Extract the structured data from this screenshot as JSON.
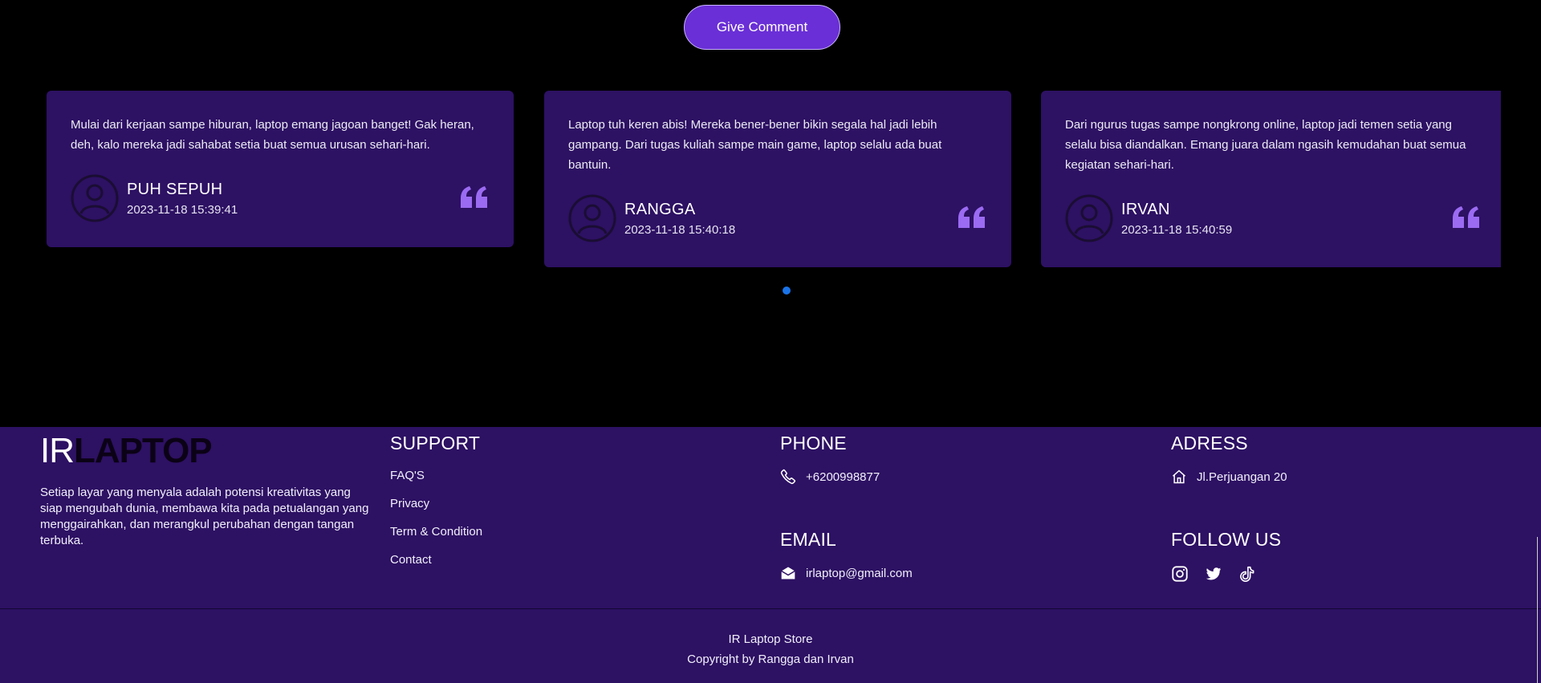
{
  "comment_button": {
    "label": "Give Comment"
  },
  "testimonials": [
    {
      "text": "Mulai dari kerjaan sampe hiburan, laptop emang jagoan banget! Gak heran, deh, kalo mereka jadi sahabat setia buat semua urusan sehari-hari.",
      "name": "PUH SEPUH",
      "date": "2023-11-18 15:39:41"
    },
    {
      "text": "Laptop tuh keren abis! Mereka bener-bener bikin segala hal jadi lebih gampang. Dari tugas kuliah sampe main game, laptop selalu ada buat bantuin.",
      "name": "RANGGA",
      "date": "2023-11-18 15:40:18"
    },
    {
      "text": "Dari ngurus tugas sampe nongkrong online, laptop jadi temen setia yang selalu bisa diandalkan. Emang juara dalam ngasih kemudahan buat semua kegiatan sehari-hari.",
      "name": "IRVAN",
      "date": "2023-11-18 15:40:59"
    }
  ],
  "footer": {
    "logo": {
      "part1": "IR",
      "part2": "LAPTOP"
    },
    "tagline": "Setiap layar yang menyala adalah potensi kreativitas yang siap mengubah dunia, membawa kita pada petualangan yang menggairahkan, dan merangkul perubahan dengan tangan terbuka.",
    "support": {
      "title": "SUPPORT",
      "links": [
        "FAQ'S",
        "Privacy",
        "Term & Condition",
        "Contact"
      ]
    },
    "phone": {
      "title": "PHONE",
      "value": "+6200998877",
      "icon": "phone-icon"
    },
    "email": {
      "title": "EMAIL",
      "value": "irlaptop@gmail.com",
      "icon": "mail-icon"
    },
    "address": {
      "title": "ADRESS",
      "value": "Jl.Perjuangan 20",
      "icon": "home-icon"
    },
    "follow": {
      "title": "FOLLOW US",
      "icons": [
        "instagram-icon",
        "twitter-icon",
        "tiktok-icon"
      ]
    },
    "copyright": {
      "line1": "IR Laptop Store",
      "line2": "Copyright by Rangga dan Irvan"
    }
  },
  "colors": {
    "background": "#000000",
    "card": "#2d1163",
    "footer": "#2d1163",
    "button": "#6a2fd6",
    "quote": "#9b6bf2",
    "dot": "#1a73e8"
  }
}
